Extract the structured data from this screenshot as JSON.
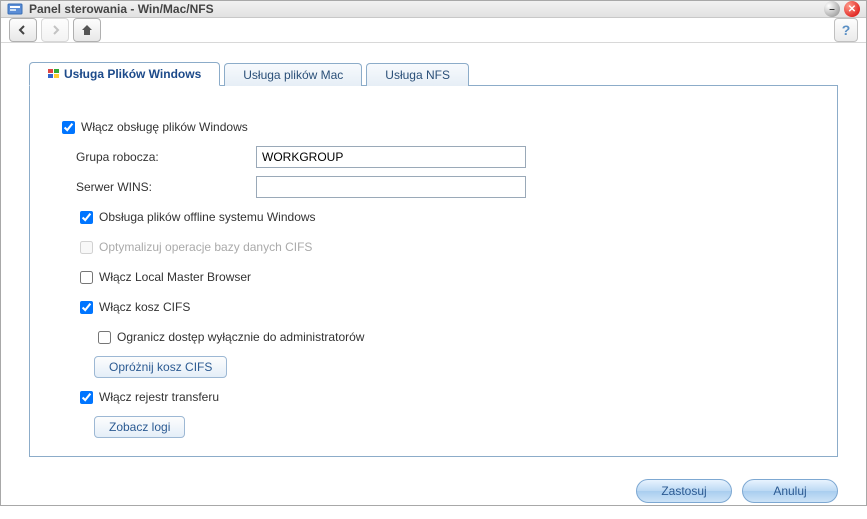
{
  "window": {
    "title": "Panel sterowania - Win/Mac/NFS"
  },
  "tabs": [
    {
      "label": "Usługa Plików Windows",
      "active": true
    },
    {
      "label": "Usługa plików Mac",
      "active": false
    },
    {
      "label": "Usługa NFS",
      "active": false
    }
  ],
  "form": {
    "enableWindows": {
      "label": "Włącz obsługę plików Windows",
      "checked": true
    },
    "workgroup": {
      "label": "Grupa robocza:",
      "value": "WORKGROUP"
    },
    "wins": {
      "label": "Serwer WINS:",
      "value": ""
    },
    "offline": {
      "label": "Obsługa plików offline systemu Windows",
      "checked": true
    },
    "optimizeCifs": {
      "label": "Optymalizuj operacje bazy danych CIFS",
      "checked": false,
      "disabled": true
    },
    "localMaster": {
      "label": "Włącz Local Master Browser",
      "checked": false
    },
    "enableRecycle": {
      "label": "Włącz kosz CIFS",
      "checked": true
    },
    "restrictAdmin": {
      "label": "Ogranicz dostęp wyłącznie do administratorów",
      "checked": false
    },
    "emptyRecycle": {
      "label": "Opróżnij kosz CIFS"
    },
    "enableTransferLog": {
      "label": "Włącz rejestr transferu",
      "checked": true
    },
    "viewLogs": {
      "label": "Zobacz logi"
    }
  },
  "footer": {
    "apply": "Zastosuj",
    "cancel": "Anuluj"
  }
}
